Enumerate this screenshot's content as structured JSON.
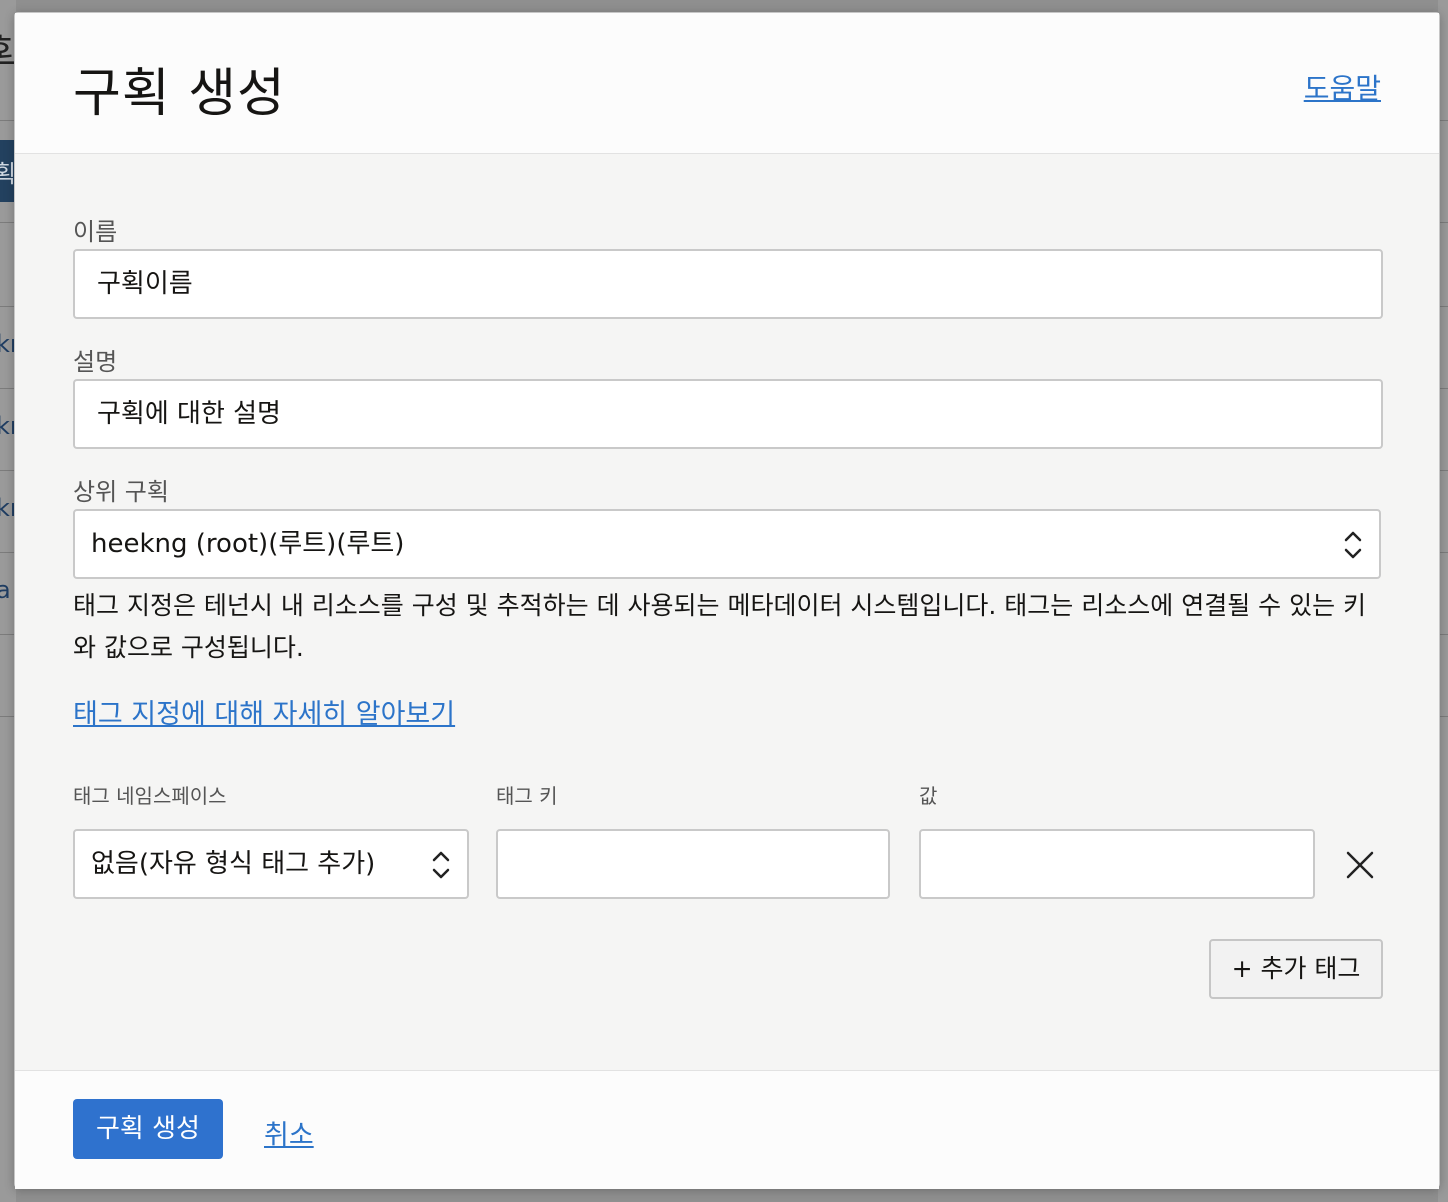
{
  "dialog": {
    "title": "구획 생성",
    "help_link": "도움말"
  },
  "form": {
    "name_label": "이름",
    "name_value": "구획이름",
    "description_label": "설명",
    "description_value": "구획에 대한 설명",
    "parent_label": "상위 구획",
    "parent_value": "heekng (root)(루트)(루트)"
  },
  "tagging": {
    "info_text": "태그 지정은 테넌시 내 리소스를 구성 및 추적하는 데 사용되는 메타데이터 시스템입니다. 태그는 리소스에 연결될 수 있는 키와 값으로 구성됩니다.",
    "learn_more_link": "태그 지정에 대해 자세히 알아보기",
    "namespace_label": "태그 네임스페이스",
    "key_label": "태그 키",
    "value_label": "값",
    "namespace_value": "없음(자유 형식 태그 추가)",
    "key_value": "",
    "value_value": "",
    "add_tag_button": "+ 추가 태그"
  },
  "footer": {
    "create_button": "구획 생성",
    "cancel_link": "취소"
  },
  "background": {
    "title_fragment": "획",
    "button_fragment": "획",
    "link_fragments": [
      "kr",
      "kr",
      "kr",
      "a"
    ]
  },
  "icons": {
    "select_arrow": "chevron-up-down-icon",
    "remove": "close-icon"
  },
  "colors": {
    "primary": "#2f72ce",
    "link": "#2c74c9"
  }
}
